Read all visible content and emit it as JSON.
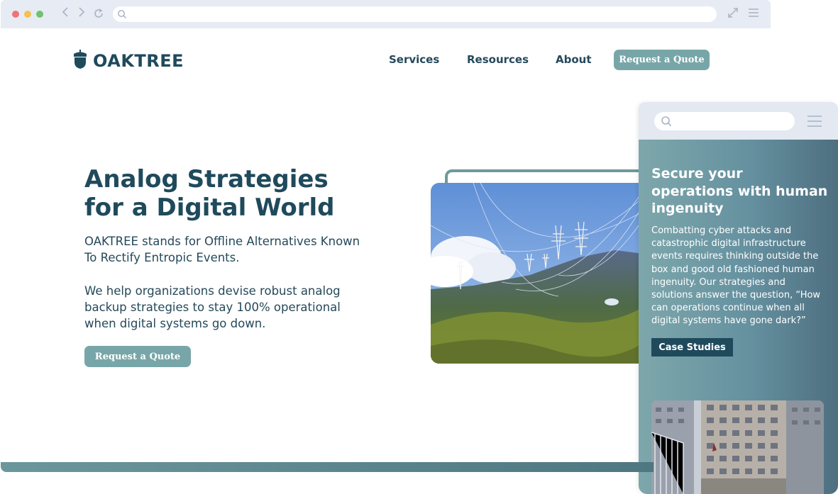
{
  "browser": {
    "back_icon": "chevron-left-icon",
    "forward_icon": "chevron-right-icon",
    "reload_icon": "reload-icon",
    "search_icon": "search-icon",
    "expand_icon": "expand-icon",
    "menu_icon": "hamburger-menu-icon",
    "address_value": ""
  },
  "header": {
    "logo_text": "OAKTREE",
    "logo_icon": "acorn-icon",
    "nav": [
      "Services",
      "Resources",
      "About"
    ],
    "cta": "Request a Quote"
  },
  "hero": {
    "title_line1": "Analog Strategies",
    "title_line2": "for a Digital World",
    "paragraph1": "OAKTREE stands for Offline Alternatives Known To Rectify Entropic Events.",
    "paragraph2": "We help organizations devise robust analog backup strategies to stay 100% operational when digital systems go down.",
    "cta": "Request a Quote",
    "image_subject": "power-line-pylons-on-mountain"
  },
  "mobile": {
    "search_value": "",
    "title": "Secure your operations with human ingenuity",
    "paragraph": "Combatting cyber attacks and catastrophic digital infrastructure events requires thinking outside the box and good old fashioned human ingenuity. Our strategies and solutions answer the question, “How can operations continue when all digital systems have gone dark?”",
    "cta": "Case Studies",
    "image_subject": "office-building"
  },
  "colors": {
    "brand_dark": "#1f4a5c",
    "brand_teal": "#78a6a8",
    "browser_chrome": "#e7ebf3"
  }
}
